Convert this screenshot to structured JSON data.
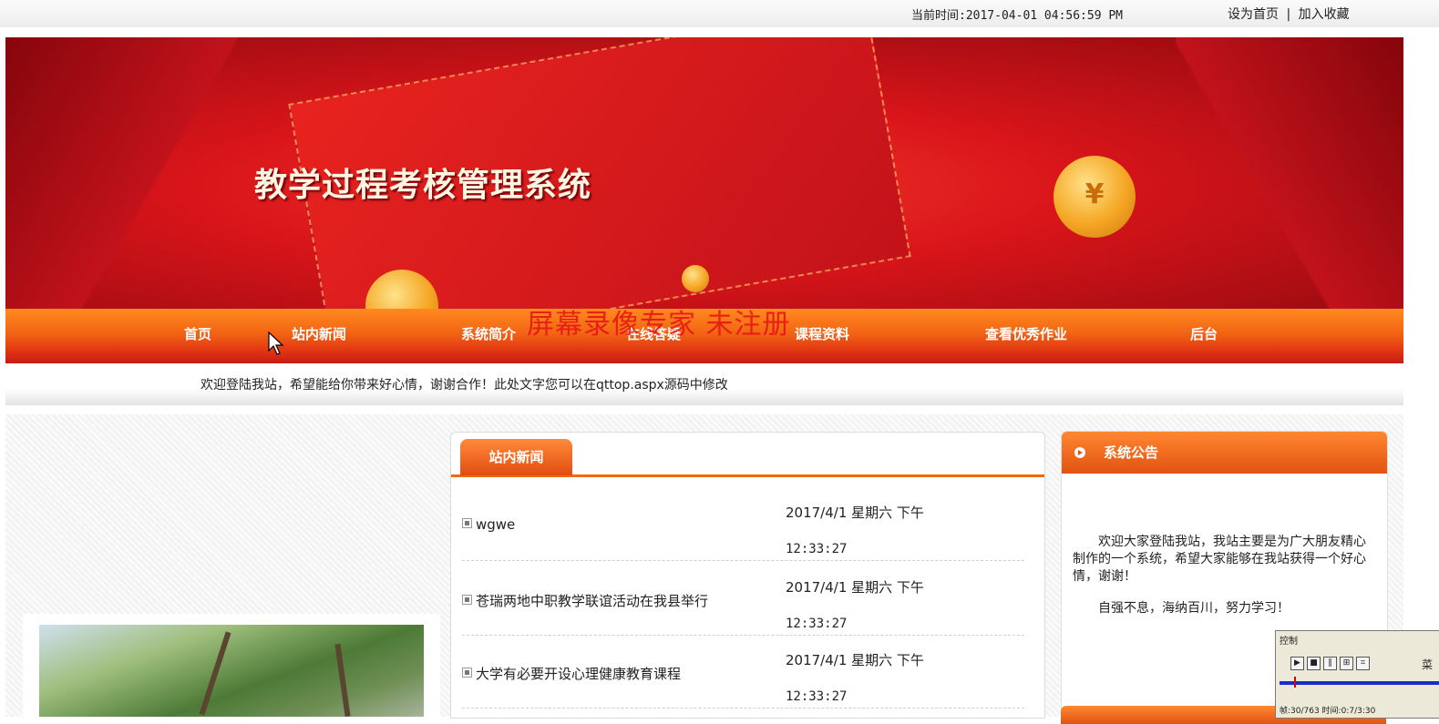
{
  "topbar": {
    "time_label": "当前时间:2017-04-01 04:56:59 PM",
    "set_homepage": "设为首页",
    "separator": "|",
    "add_favorite": "加入收藏"
  },
  "banner": {
    "title": "教学过程考核管理系统",
    "coin_symbol": "¥"
  },
  "nav": {
    "items": [
      {
        "label": "首页"
      },
      {
        "label": "站内新闻"
      },
      {
        "label": "系统简介"
      },
      {
        "label": "在线答疑"
      },
      {
        "label": "课程资料"
      },
      {
        "label": "查看优秀作业"
      },
      {
        "label": "后台"
      }
    ]
  },
  "watermark": "屏幕录像专家 未注册",
  "welcome_text": "欢迎登陆我站，希望能给你带来好心情，谢谢合作！此处文字您可以在qttop.aspx源码中修改",
  "news": {
    "tab_label": "站内新闻",
    "rows": [
      {
        "title": "wgwe",
        "date": "2017/4/1 星期六 下午",
        "time": "12:33:27"
      },
      {
        "title": "苍瑞两地中职教学联谊活动在我县举行",
        "date": "2017/4/1 星期六 下午",
        "time": "12:33:27"
      },
      {
        "title": "大学有必要开设心理健康教育课程",
        "date": "2017/4/1 星期六 下午",
        "time": "12:33:27"
      }
    ]
  },
  "notice": {
    "title": "系统公告",
    "paragraph1": "欢迎大家登陆我站，我站主要是为广大朋友精心制作的一个系统，希望大家能够在我站获得一个好心情，谢谢！",
    "paragraph2": "自强不息，海纳百川，努力学习！"
  },
  "recorder": {
    "title": "控制",
    "menu_label": "菜",
    "status": "帧:30/763 时间:0:7/3:30"
  }
}
